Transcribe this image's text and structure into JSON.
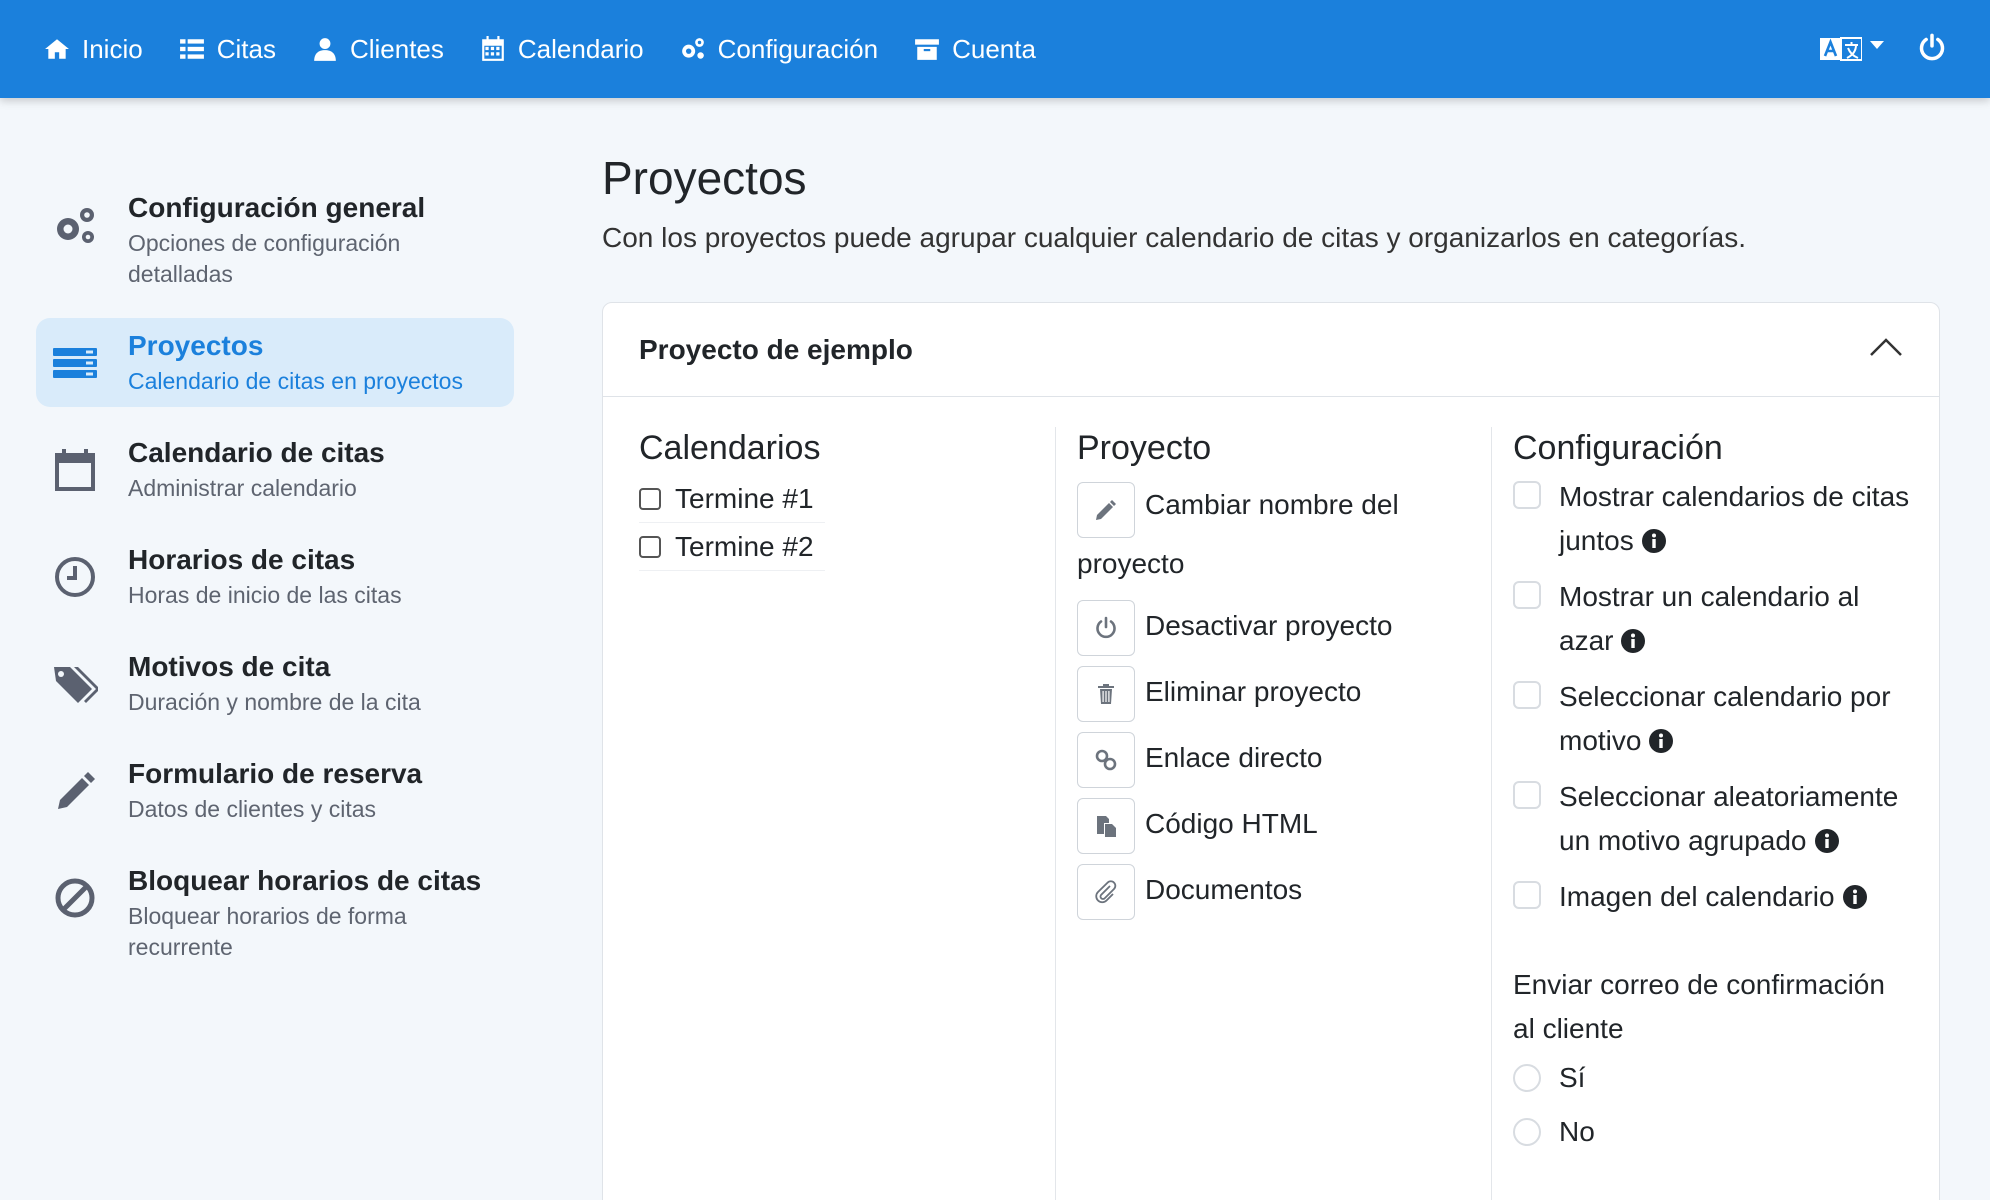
{
  "nav": {
    "items": [
      {
        "label": "Inicio",
        "icon": "home-icon"
      },
      {
        "label": "Citas",
        "icon": "list-icon"
      },
      {
        "label": "Clientes",
        "icon": "user-icon"
      },
      {
        "label": "Calendario",
        "icon": "calendar-icon"
      },
      {
        "label": "Configuración",
        "icon": "gears-icon"
      },
      {
        "label": "Cuenta",
        "icon": "archive-icon"
      }
    ]
  },
  "sidebar": {
    "items": [
      {
        "title": "Configuración general",
        "subtitle": "Opciones de configuración detalladas"
      },
      {
        "title": "Proyectos",
        "subtitle": "Calendario de citas en proyectos"
      },
      {
        "title": "Calendario de citas",
        "subtitle": "Administrar calendario"
      },
      {
        "title": "Horarios de citas",
        "subtitle": "Horas de inicio de las citas"
      },
      {
        "title": "Motivos de cita",
        "subtitle": "Duración y nombre de la cita"
      },
      {
        "title": "Formulario de reserva",
        "subtitle": "Datos de clientes y citas"
      },
      {
        "title": "Bloquear horarios de citas",
        "subtitle": "Bloquear horarios de forma recurrente"
      }
    ]
  },
  "main": {
    "title": "Proyectos",
    "description": "Con los proyectos puede agrupar cualquier calendario de citas y organizarlos en categorías."
  },
  "project": {
    "name": "Proyecto de ejemplo",
    "calendars_heading": "Calendarios",
    "calendars": [
      "Termine #1",
      "Termine #2"
    ],
    "project_heading": "Proyecto",
    "actions": [
      "Cambiar nombre del proyecto",
      "Desactivar proyecto",
      "Eliminar proyecto",
      "Enlace directo",
      "Código HTML",
      "Documentos"
    ],
    "settings_heading": "Configuración",
    "settings": [
      "Mostrar calendarios de citas juntos",
      "Mostrar un calendario al azar",
      "Seleccionar calendario por motivo",
      "Seleccionar aleatoriamente un motivo agrupado",
      "Imagen del calendario"
    ],
    "email_label": "Enviar correo de confirmación al cliente",
    "email_options": [
      "Sí",
      "No"
    ]
  }
}
